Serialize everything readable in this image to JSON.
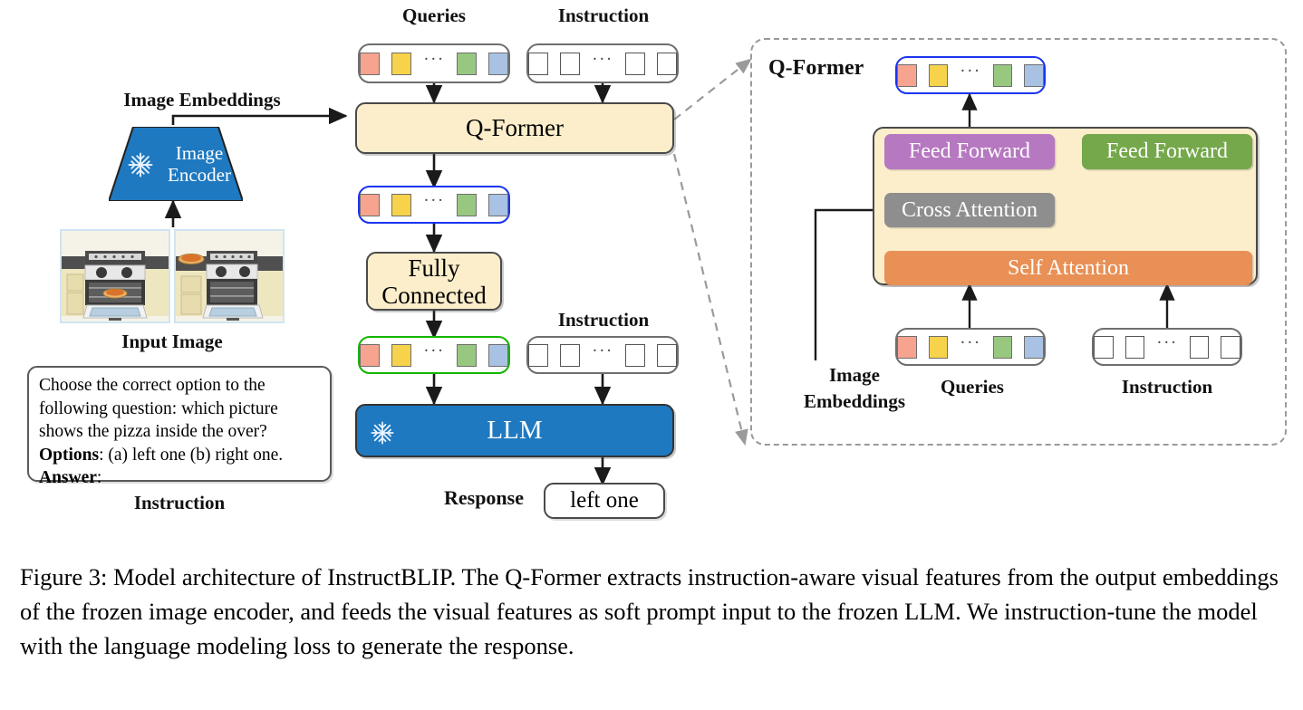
{
  "figure": {
    "caption": "Figure 3: Model architecture of InstructBLIP. The Q-Former extracts instruction-aware visual features from the output embeddings of the frozen image encoder, and feeds the visual features as soft prompt input to the frozen LLM. We instruction-tune the model with the language modeling loss to generate the response."
  },
  "colors": {
    "cream": "#fceecb",
    "blue": "#1f79c0",
    "purple": "#b678c0",
    "green": "#74a84a",
    "gray": "#8e8e8e",
    "orange": "#e89055",
    "token_red": "#f6a38f",
    "token_yellow": "#f7d24b",
    "token_green": "#98c880",
    "token_blue": "#a9c1e3",
    "outline_blue": "#1a34ef",
    "outline_green": "#13b500",
    "dashed_gray": "#9a9a9a"
  },
  "main_pipeline": {
    "queries_label": "Queries",
    "instruction_label_top": "Instruction",
    "instruction_label_mid": "Instruction",
    "image_embeddings_label": "Image Embeddings",
    "image_encoder_label": "Image\nEncoder",
    "image_encoder_line1": "Image",
    "image_encoder_line2": "Encoder",
    "input_image_label": "Input Image",
    "qformer_label": "Q-Former",
    "fully_connected_line1": "Fully",
    "fully_connected_line2": "Connected",
    "llm_label": "LLM",
    "response_label": "Response",
    "response_value": "left one",
    "instruction_caption": "Instruction",
    "instruction_text": {
      "line1": "Choose the correct option to the",
      "line2": "following question: which picture",
      "line3": "shows the pizza inside the over?",
      "options_key": "Options",
      "options_value": ": (a) left one (b) right one.",
      "answer_key": "Answer",
      "answer_value": ":"
    }
  },
  "detail_panel": {
    "title": "Q-Former",
    "feed_forward_left": "Feed Forward",
    "feed_forward_right": "Feed Forward",
    "cross_attention": "Cross Attention",
    "self_attention": "Self Attention",
    "image_embeddings_line1": "Image",
    "image_embeddings_line2": "Embeddings",
    "queries_label": "Queries",
    "instruction_label": "Instruction"
  },
  "tokens": {
    "colored": [
      "token_red",
      "token_yellow",
      "dots",
      "token_green",
      "token_blue"
    ],
    "empty_count": 4,
    "ellipsis": "···"
  },
  "icons": {
    "frozen": "snowflake-icon"
  }
}
